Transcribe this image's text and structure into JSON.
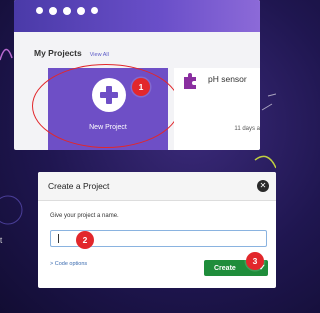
{
  "top": {
    "projects_title": "My Projects",
    "view_all": "View All",
    "new_project_label": "New Project",
    "tiles": [
      {
        "name": "pH sensor",
        "modified": "11 days a",
        "icon": "puzzle-icon"
      }
    ]
  },
  "dialog": {
    "title": "Create a Project",
    "prompt": "Give your project a name.",
    "input_value": "",
    "code_options": "Code options",
    "create_label": "Create"
  },
  "badges": [
    "1",
    "2",
    "3"
  ],
  "side_text": "t",
  "colors": {
    "accent_purple": "#6e4fc6",
    "highlight_red": "#e2272b",
    "create_green": "#1f8d3b"
  }
}
